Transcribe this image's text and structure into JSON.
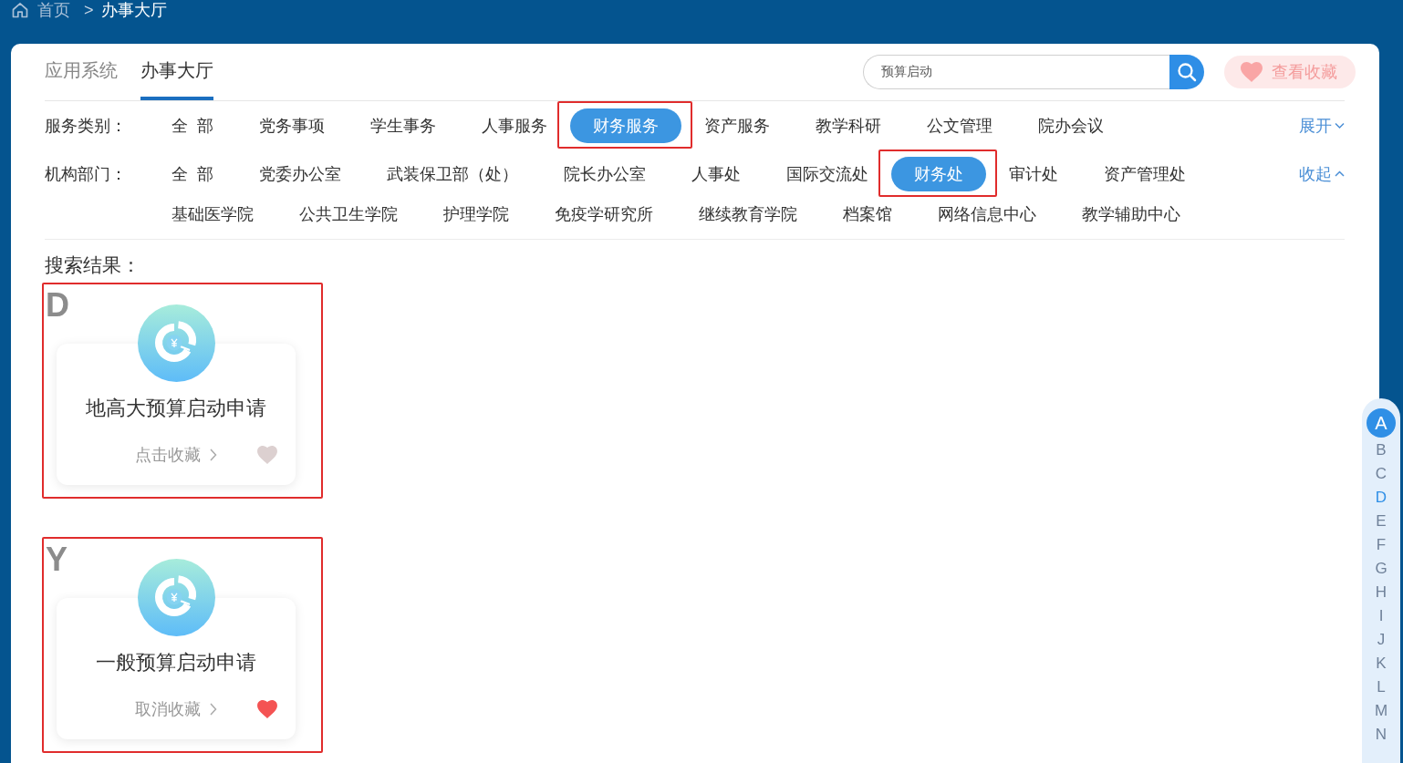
{
  "breadcrumb": {
    "items": [
      "首页",
      "办事大厅"
    ],
    "separator": ">"
  },
  "tabs": [
    {
      "label": "应用系统",
      "selected": false
    },
    {
      "label": "办事大厅",
      "selected": true
    }
  ],
  "search": {
    "value": "预算启动"
  },
  "favorites_button": {
    "label": "查看收藏"
  },
  "filters": [
    {
      "label": "服务类别：",
      "toggle": {
        "label": "展开",
        "expanded": false
      },
      "options": [
        {
          "label": "全 部",
          "selected": false,
          "highlighted": false
        },
        {
          "label": "党务事项",
          "selected": false,
          "highlighted": false
        },
        {
          "label": "学生事务",
          "selected": false,
          "highlighted": false
        },
        {
          "label": "人事服务",
          "selected": false,
          "highlighted": false
        },
        {
          "label": "财务服务",
          "selected": true,
          "highlighted": true
        },
        {
          "label": "资产服务",
          "selected": false,
          "highlighted": false
        },
        {
          "label": "教学科研",
          "selected": false,
          "highlighted": false
        },
        {
          "label": "公文管理",
          "selected": false,
          "highlighted": false
        },
        {
          "label": "院办会议",
          "selected": false,
          "highlighted": false
        }
      ]
    },
    {
      "label": "机构部门：",
      "toggle": {
        "label": "收起",
        "expanded": true
      },
      "options": [
        {
          "label": "全 部",
          "selected": false,
          "highlighted": false
        },
        {
          "label": "党委办公室",
          "selected": false,
          "highlighted": false
        },
        {
          "label": "武装保卫部（处）",
          "selected": false,
          "highlighted": false
        },
        {
          "label": "院长办公室",
          "selected": false,
          "highlighted": false
        },
        {
          "label": "人事处",
          "selected": false,
          "highlighted": false
        },
        {
          "label": "国际交流处",
          "selected": false,
          "highlighted": false
        },
        {
          "label": "财务处",
          "selected": true,
          "highlighted": true
        },
        {
          "label": "审计处",
          "selected": false,
          "highlighted": false
        },
        {
          "label": "资产管理处",
          "selected": false,
          "highlighted": false
        },
        {
          "label": "基础医学院",
          "selected": false,
          "highlighted": false
        },
        {
          "label": "公共卫生学院",
          "selected": false,
          "highlighted": false
        },
        {
          "label": "护理学院",
          "selected": false,
          "highlighted": false
        },
        {
          "label": "免疫学研究所",
          "selected": false,
          "highlighted": false
        },
        {
          "label": "继续教育学院",
          "selected": false,
          "highlighted": false
        },
        {
          "label": "档案馆",
          "selected": false,
          "highlighted": false
        },
        {
          "label": "网络信息中心",
          "selected": false,
          "highlighted": false
        },
        {
          "label": "教学辅助中心",
          "selected": false,
          "highlighted": false
        }
      ]
    }
  ],
  "results": {
    "title": "搜索结果：",
    "groups": [
      {
        "letter": "D",
        "highlighted": true,
        "items": [
          {
            "title": "地高大预算启动申请",
            "action": "点击收藏",
            "favorited": false
          }
        ]
      },
      {
        "letter": "Y",
        "highlighted": true,
        "items": [
          {
            "title": "一般预算启动申请",
            "action": "取消收藏",
            "favorited": true
          }
        ]
      }
    ]
  },
  "alphabet": [
    {
      "letter": "A",
      "selected": true,
      "disabled": false
    },
    {
      "letter": "B",
      "selected": false,
      "disabled": true
    },
    {
      "letter": "C",
      "selected": false,
      "disabled": true
    },
    {
      "letter": "D",
      "selected": false,
      "disabled": false
    },
    {
      "letter": "E",
      "selected": false,
      "disabled": true
    },
    {
      "letter": "F",
      "selected": false,
      "disabled": true
    },
    {
      "letter": "G",
      "selected": false,
      "disabled": true
    },
    {
      "letter": "H",
      "selected": false,
      "disabled": true
    },
    {
      "letter": "I",
      "selected": false,
      "disabled": true
    },
    {
      "letter": "J",
      "selected": false,
      "disabled": true
    },
    {
      "letter": "K",
      "selected": false,
      "disabled": true
    },
    {
      "letter": "L",
      "selected": false,
      "disabled": true
    },
    {
      "letter": "M",
      "selected": false,
      "disabled": true
    },
    {
      "letter": "N",
      "selected": false,
      "disabled": true
    }
  ]
}
